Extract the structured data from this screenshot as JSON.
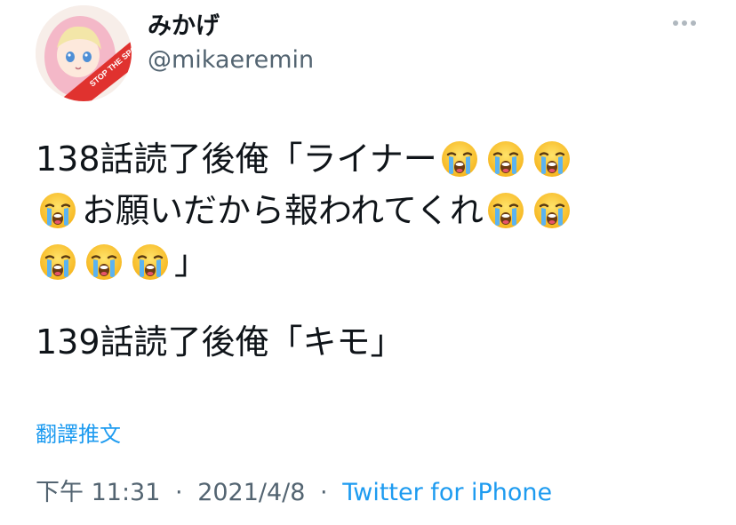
{
  "user": {
    "display_name": "みかげ",
    "handle": "@mikaeremin",
    "avatar_badge_text": "STOP THE SPOILERS"
  },
  "more_icon": "more-dots-icon",
  "tweet": {
    "line1_text": "138話読了後俺「ライナー",
    "line2_text_a": "お願いだから報われてくれ",
    "line3_text_end": "」",
    "line4_text": "139話読了後俺「キモ」",
    "emoji_name": "loudly-crying-face-icon"
  },
  "translate_label": "翻譯推文",
  "meta": {
    "time": "下午 11:31",
    "separator": "·",
    "date": "2021/4/8",
    "source": "Twitter for iPhone"
  },
  "colors": {
    "accent": "#1d9bf0",
    "secondary_text": "#536471",
    "primary_text": "#0f1419",
    "badge_red": "#e0322f"
  }
}
